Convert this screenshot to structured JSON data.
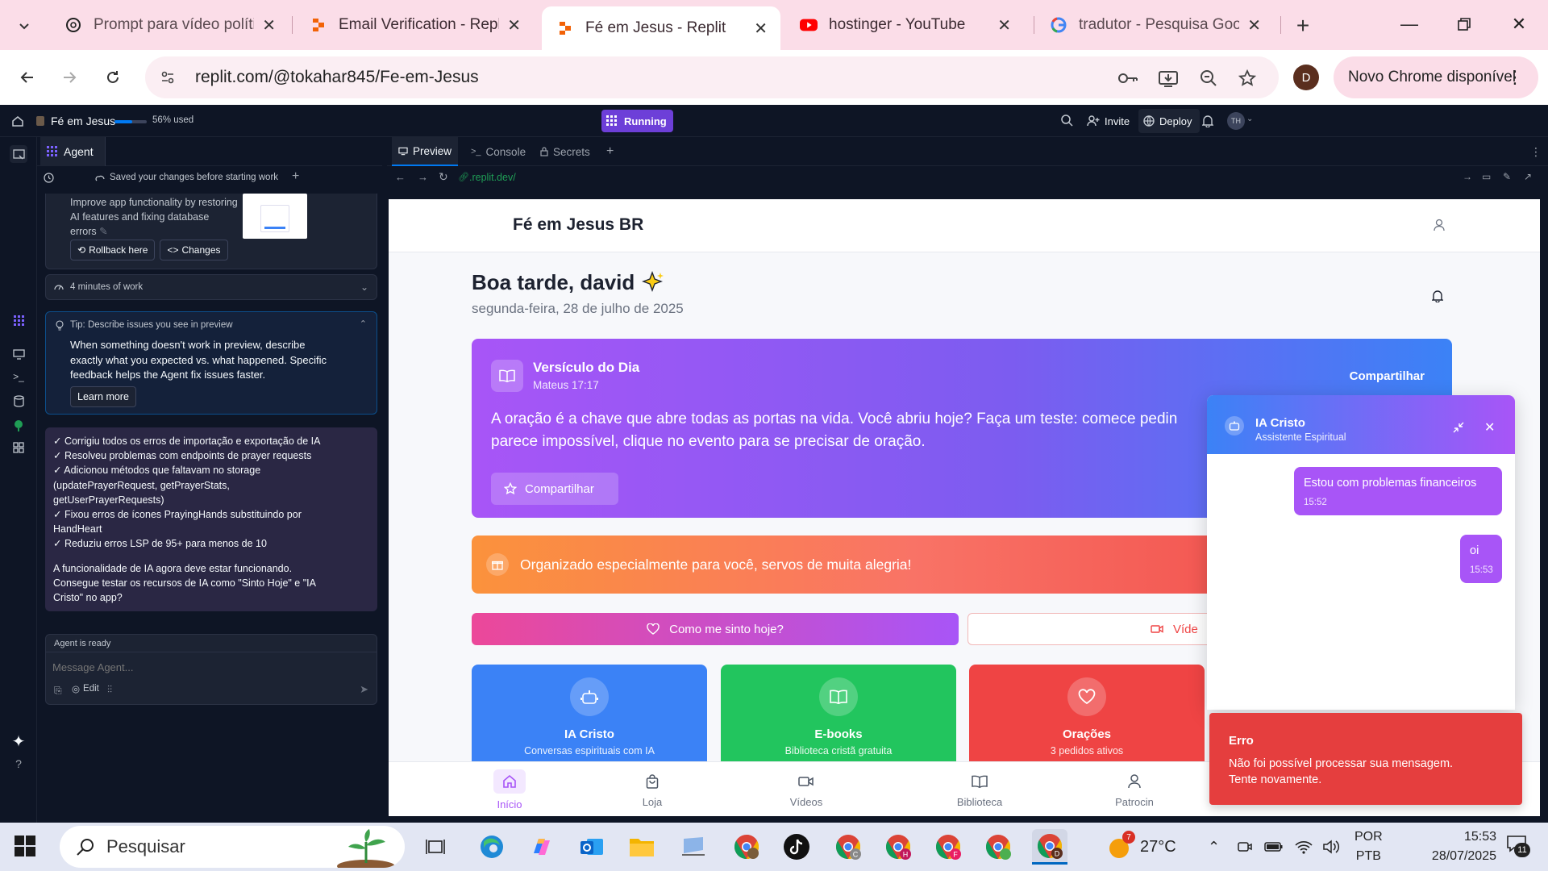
{
  "browser": {
    "tabs": [
      {
        "title": "Prompt para vídeo político",
        "icon": "openai-icon",
        "active": false
      },
      {
        "title": "Email Verification - Replit",
        "icon": "replit-icon",
        "active": false
      },
      {
        "title": "Fé em Jesus - Replit",
        "icon": "replit-icon",
        "active": true
      },
      {
        "title": "hostinger - YouTube",
        "icon": "youtube-icon",
        "active": false
      },
      {
        "title": "tradutor - Pesquisa Google",
        "icon": "google-icon",
        "active": false
      }
    ],
    "url": "replit.com/@tokahar845/Fe-em-Jesus",
    "profile_initial": "D",
    "update_label": "Novo Chrome disponível"
  },
  "replit": {
    "project_name": "Fé em Jesus",
    "usage": "56% used",
    "usage_fraction": 0.56,
    "run_status": "Running",
    "invite_label": "Invite",
    "deploy_label": "Deploy",
    "user_initials": "TH",
    "agent_tab": "Agent",
    "agent_status_top": "Saved your changes before starting work",
    "checkpoint": {
      "text_line1": "Improve app functionality by restoring",
      "text_line2": "AI features and fixing database",
      "text_line3": "errors",
      "rollback_label": "Rollback here",
      "changes_label": "Changes"
    },
    "work_time": "4 minutes of work",
    "tip": {
      "title": "Tip: Describe issues you see in preview",
      "body_line1": "When something doesn't work in preview, describe",
      "body_line2": "exactly what you expected vs. what happened. Specific",
      "body_line3": "feedback helps the Agent fix issues faster.",
      "learn_more": "Learn more"
    },
    "agent_message": [
      "✓ Corrigiu todos os erros de importação e exportação de IA",
      "✓ Resolveu problemas com endpoints de prayer requests",
      "✓ Adicionou métodos que faltavam no storage",
      "(updatePrayerRequest, getPrayerStats,",
      "getUserPrayerRequests)",
      "✓ Fixou erros de ícones PrayingHands substituindo por",
      "HandHeart",
      "✓ Reduziu erros LSP de 95+ para menos de 10"
    ],
    "agent_message_2": [
      "A funcionalidade de IA agora deve estar funcionando.",
      "Consegue testar os recursos de IA como \"Sinto Hoje\" e \"IA",
      "Cristo\" no app?"
    ],
    "agent_ready": "Agent is ready",
    "message_placeholder": "Message Agent...",
    "edit_label": "Edit",
    "preview_tabs": [
      "Preview",
      "Console",
      "Secrets"
    ],
    "preview_url": ".replit.dev/"
  },
  "app": {
    "title": "Fé em Jesus BR",
    "greeting": "Boa tarde, david",
    "date": "segunda-feira, 28 de julho de 2025",
    "verse": {
      "heading": "Versículo do Dia",
      "reference": "Mateus 17:17",
      "share_top": "Compartilhar",
      "text_line1": "A oração é a chave que abre todas as portas na vida. Você abriu hoje? Faça um teste: comece pedin",
      "text_line2": "parece impossível, clique no evento para se precisar de oração.",
      "share_button": "Compartilhar"
    },
    "banner": "Organizado especialmente para você, servos de muita alegria!",
    "feel_button": "Como me sinto hoje?",
    "video_button": "Víde",
    "features": [
      {
        "title": "IA Cristo",
        "subtitle": "Conversas espirituais com IA",
        "color": "#3b82f6"
      },
      {
        "title": "E-books",
        "subtitle": "Biblioteca cristã gratuita",
        "color": "#22c55e"
      },
      {
        "title": "Orações",
        "subtitle": "3 pedidos ativos",
        "color": "#ef4444"
      }
    ],
    "bottom_nav": [
      "Início",
      "Loja",
      "Vídeos",
      "Biblioteca",
      "Patrocin"
    ],
    "chat": {
      "title": "IA Cristo",
      "subtitle": "Assistente Espiritual",
      "messages": [
        {
          "text": "Estou com problemas financeiros",
          "time": "15:52"
        },
        {
          "text": "oi",
          "time": "15:53"
        }
      ]
    },
    "toast": {
      "title": "Erro",
      "message_line1": "Não foi possível processar sua mensagem.",
      "message_line2": "Tente novamente."
    }
  },
  "taskbar": {
    "search_placeholder": "Pesquisar",
    "weather_temp": "27°C",
    "weather_badge": "7",
    "lang_line1": "POR",
    "lang_line2": "PTB",
    "time": "15:53",
    "date": "28/07/2025",
    "notif_count": "11"
  }
}
